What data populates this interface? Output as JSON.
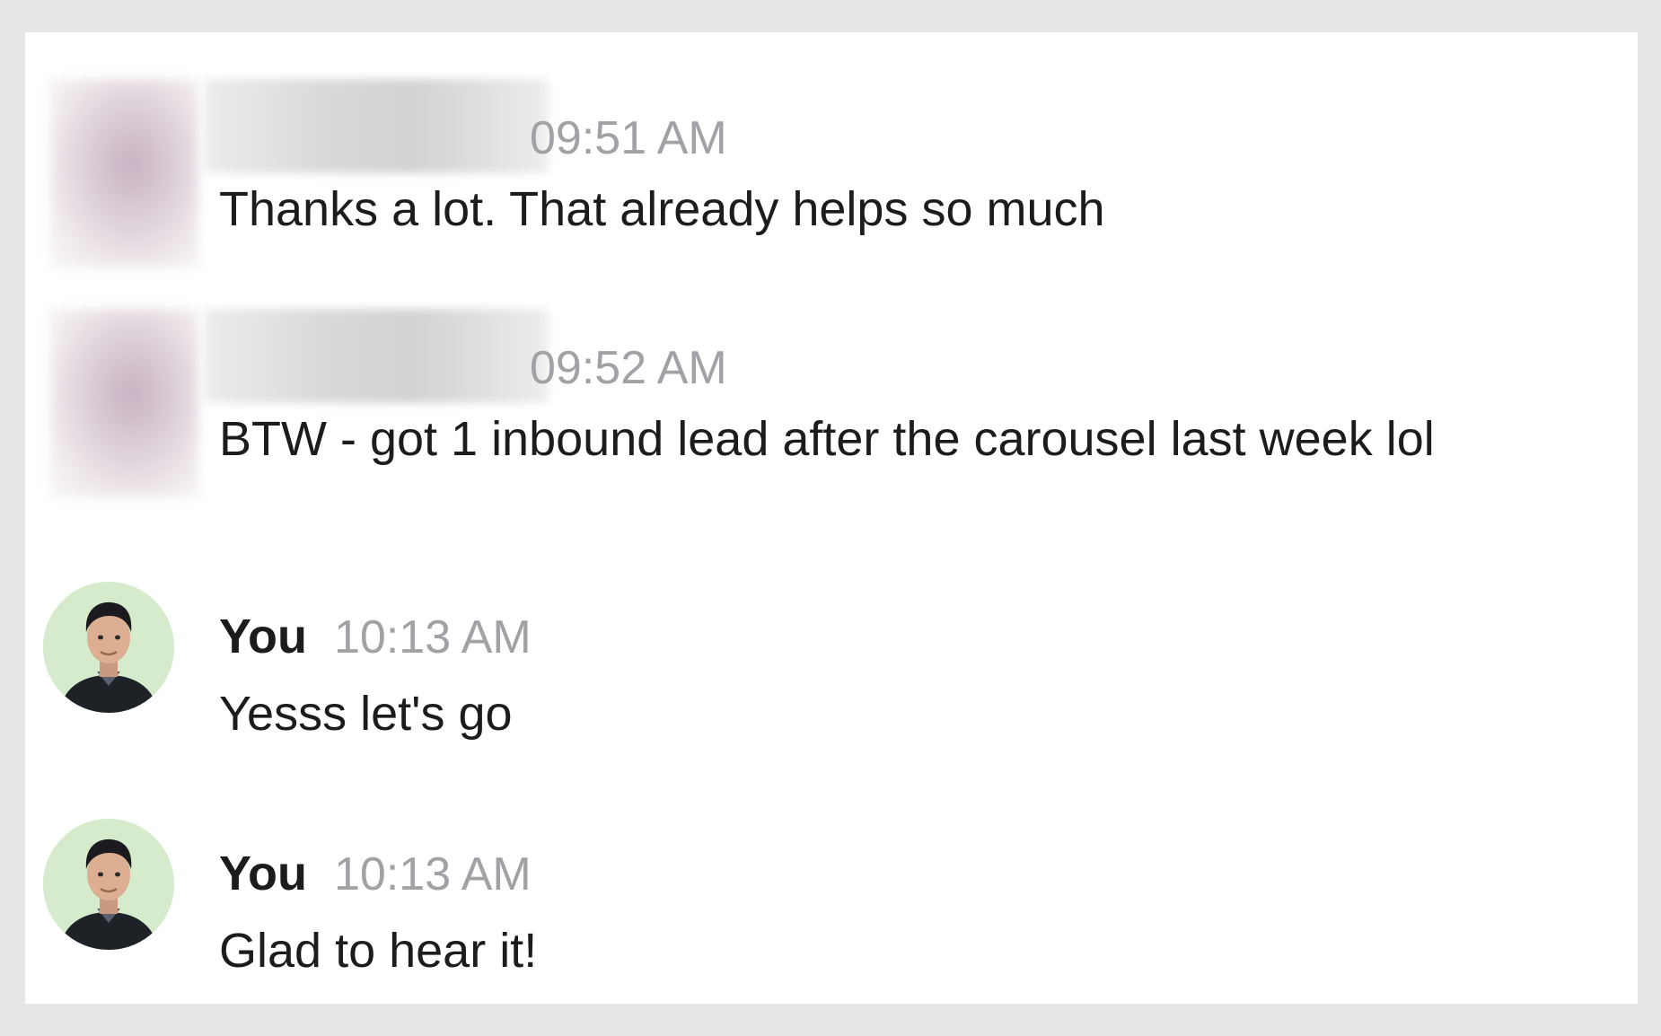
{
  "messages": [
    {
      "kind": "other",
      "author": "",
      "time": "09:51 AM",
      "text": "Thanks a lot. That already helps so much"
    },
    {
      "kind": "other",
      "author": "",
      "time": "09:52 AM",
      "text": "BTW - got 1 inbound lead after the carousel last week lol"
    },
    {
      "kind": "self",
      "author": "You",
      "time": "10:13 AM",
      "text": "Yesss let's go"
    },
    {
      "kind": "self",
      "author": "You",
      "time": "10:13 AM",
      "text": "Glad to hear it!"
    }
  ],
  "icons": {
    "self_avatar": "user-avatar-photo"
  },
  "colors": {
    "background": "#e6e6e6",
    "panel": "#ffffff",
    "text": "#1c1c1e",
    "timestamp": "#a1a1a6",
    "avatar_bg": "#d5ebcc"
  }
}
